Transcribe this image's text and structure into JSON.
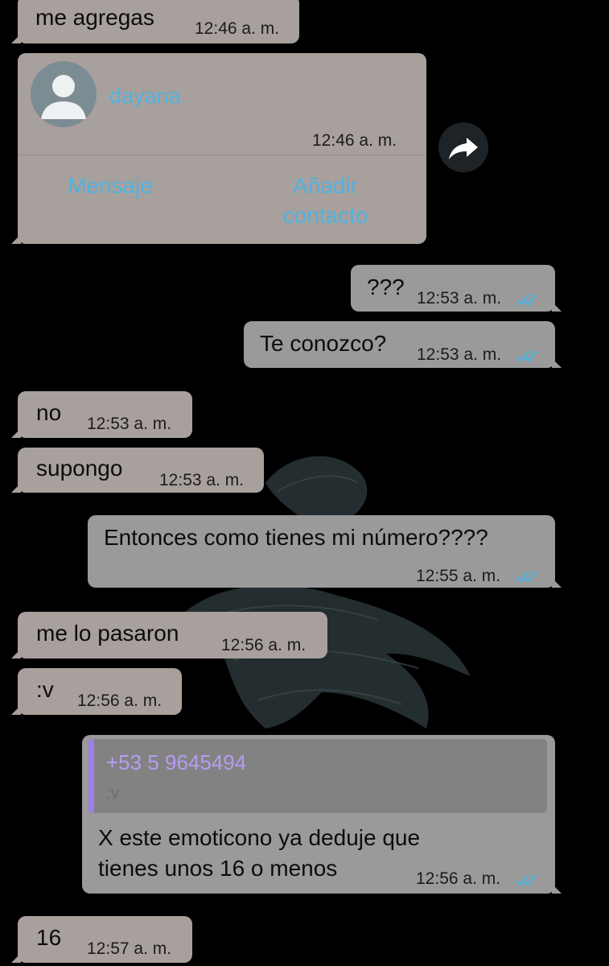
{
  "messages": [
    {
      "text": "me agregas",
      "time": "12:46 a. m."
    },
    {
      "text": "???",
      "time": "12:53 a. m."
    },
    {
      "text": "Te conozco?",
      "time": "12:53 a. m."
    },
    {
      "text": "no",
      "time": "12:53 a. m."
    },
    {
      "text": "supongo",
      "time": "12:53 a. m."
    },
    {
      "text": "Entonces como tienes mi número????",
      "time": "12:55 a. m."
    },
    {
      "text": "me lo pasaron",
      "time": "12:56 a. m."
    },
    {
      "text": ":v",
      "time": "12:56 a. m."
    },
    {
      "text_line1": "X este emoticono ya deduje que",
      "text_line2": "tienes unos 16 o menos",
      "time": "12:56 a. m."
    },
    {
      "text": "16",
      "time": "12:57 a. m."
    }
  ],
  "contact_card": {
    "name": "dayana",
    "time": "12:46 a. m.",
    "message_button": "Mensaje",
    "add_contact_line1": "Añadir",
    "add_contact_line2": "contacto"
  },
  "reply_quote": {
    "sender": "+53 5 9645494",
    "text": ":v"
  },
  "icons": {
    "avatar": "default-avatar-icon",
    "forward": "forward-arrow-icon",
    "read_receipt": "double-check-icon"
  },
  "colors": {
    "incoming_bubble": "#a8a09d",
    "outgoing_bubble": "#9a9a9a",
    "link": "#4fb3e0",
    "ticks": "#4fb3e0",
    "quote_bar": "#9d7eea"
  }
}
